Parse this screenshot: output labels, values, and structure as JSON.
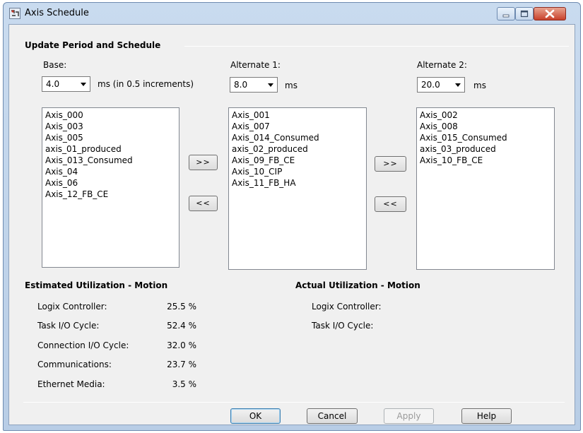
{
  "window": {
    "title": "Axis Schedule",
    "accent": "#3c7fb1"
  },
  "schedule": {
    "group_title": "Update Period and Schedule",
    "base": {
      "label": "Base:",
      "value": "4.0",
      "unit": "ms (in 0.5 increments)",
      "items": [
        "Axis_000",
        "Axis_003",
        "Axis_005",
        "axis_01_produced",
        "Axis_013_Consumed",
        "Axis_04",
        "Axis_06",
        "Axis_12_FB_CE"
      ]
    },
    "alt1": {
      "label": "Alternate 1:",
      "value": "8.0",
      "unit": "ms",
      "items": [
        "Axis_001",
        "Axis_007",
        "Axis_014_Consumed",
        "axis_02_produced",
        "Axis_09_FB_CE",
        "Axis_10_CIP",
        "Axis_11_FB_HA"
      ]
    },
    "alt2": {
      "label": "Alternate 2:",
      "value": "20.0",
      "unit": "ms",
      "items": [
        "Axis_002",
        "Axis_008",
        "Axis_015_Consumed",
        "axis_03_produced",
        "Axis_10_FB_CE"
      ]
    },
    "move_right_label": ">>",
    "move_left_label": "<<"
  },
  "estimated": {
    "title": "Estimated Utilization - Motion",
    "rows": [
      {
        "label": "Logix Controller:",
        "value": "25.5 %"
      },
      {
        "label": "Task I/O Cycle:",
        "value": "52.4 %"
      },
      {
        "label": "Connection I/O Cycle:",
        "value": "32.0 %"
      },
      {
        "label": "Communications:",
        "value": "23.7 %"
      },
      {
        "label": "Ethernet Media:",
        "value": "3.5 %"
      }
    ]
  },
  "actual": {
    "title": "Actual Utilization - Motion",
    "rows": [
      {
        "label": "Logix Controller:"
      },
      {
        "label": "Task I/O Cycle:"
      }
    ]
  },
  "buttons": {
    "ok": "OK",
    "cancel": "Cancel",
    "apply": "Apply",
    "help": "Help"
  },
  "icons": {
    "app": "axis-schedule-icon",
    "minimize": "minimize-icon",
    "maximize": "maximize-icon",
    "close": "close-icon"
  }
}
